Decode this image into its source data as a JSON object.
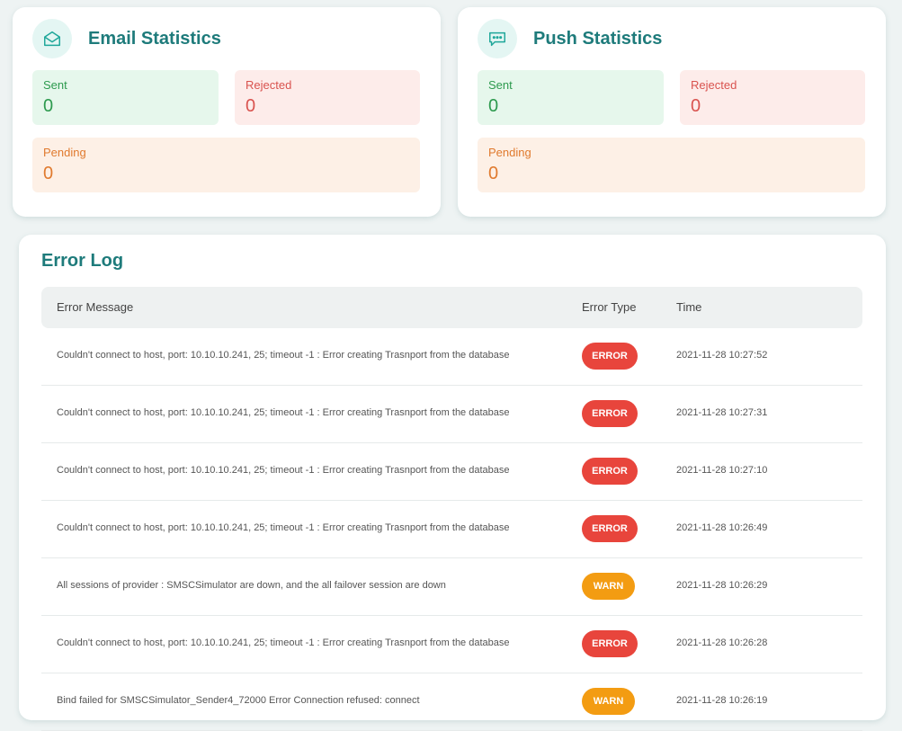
{
  "email": {
    "title": "Email Statistics",
    "icon": "envelope-open-icon",
    "sent_label": "Sent",
    "sent_value": "0",
    "rejected_label": "Rejected",
    "rejected_value": "0",
    "pending_label": "Pending",
    "pending_value": "0"
  },
  "push": {
    "title": "Push Statistics",
    "icon": "chat-bubble-icon",
    "sent_label": "Sent",
    "sent_value": "0",
    "rejected_label": "Rejected",
    "rejected_value": "0",
    "pending_label": "Pending",
    "pending_value": "0"
  },
  "colors": {
    "accent": "#1e7b7b",
    "error_badge": "#e8453c",
    "warn_badge": "#f39c12"
  },
  "error_log": {
    "title": "Error Log",
    "columns": {
      "message": "Error Message",
      "type": "Error Type",
      "time": "Time"
    },
    "rows": [
      {
        "message": "Couldn't connect to host, port: 10.10.10.241, 25; timeout -1 : Error creating Trasnport from the database",
        "type": "ERROR",
        "time": "2021-11-28 10:27:52"
      },
      {
        "message": "Couldn't connect to host, port: 10.10.10.241, 25; timeout -1 : Error creating Trasnport from the database",
        "type": "ERROR",
        "time": "2021-11-28 10:27:31"
      },
      {
        "message": "Couldn't connect to host, port: 10.10.10.241, 25; timeout -1 : Error creating Trasnport from the database",
        "type": "ERROR",
        "time": "2021-11-28 10:27:10"
      },
      {
        "message": "Couldn't connect to host, port: 10.10.10.241, 25; timeout -1 : Error creating Trasnport from the database",
        "type": "ERROR",
        "time": "2021-11-28 10:26:49"
      },
      {
        "message": "All sessions of provider : SMSCSimulator are down, and the all failover session are down",
        "type": "WARN",
        "time": "2021-11-28 10:26:29"
      },
      {
        "message": "Couldn't connect to host, port: 10.10.10.241, 25; timeout -1 : Error creating Trasnport from the database",
        "type": "ERROR",
        "time": "2021-11-28 10:26:28"
      },
      {
        "message": "Bind failed for SMSCSimulator_Sender4_72000 Error Connection refused: connect",
        "type": "WARN",
        "time": "2021-11-28 10:26:19"
      }
    ]
  }
}
